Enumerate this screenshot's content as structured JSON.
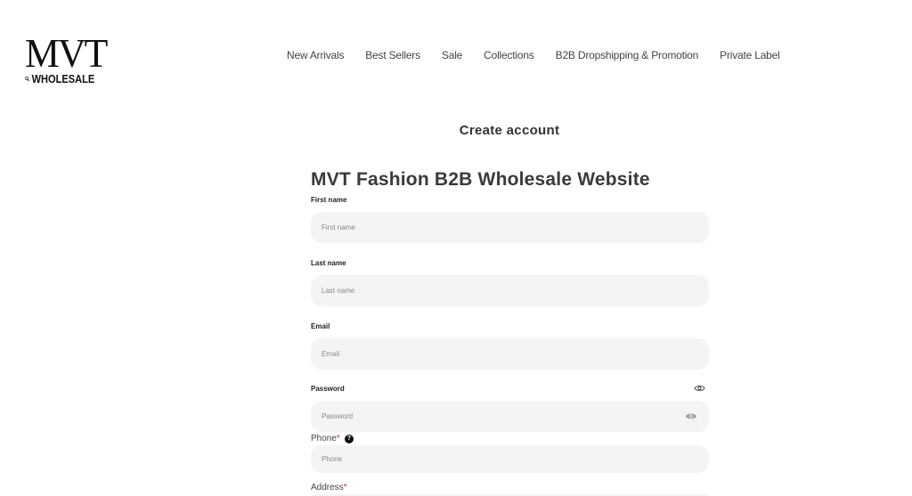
{
  "header": {
    "logo_mark": "MVT",
    "logo_sub": "WHOLESALE",
    "nav": [
      {
        "label": "New Arrivals"
      },
      {
        "label": "Best Sellers"
      },
      {
        "label": "Sale"
      },
      {
        "label": "Collections"
      },
      {
        "label": "B2B Dropshipping & Promotion"
      },
      {
        "label": "Private Label"
      }
    ]
  },
  "form": {
    "page_title": "Create account",
    "store_title": "MVT Fashion B2B Wholesale Website",
    "first_name": {
      "label": "First name",
      "placeholder": "First name"
    },
    "last_name": {
      "label": "Last name",
      "placeholder": "Last name"
    },
    "email": {
      "label": "Email",
      "placeholder": "Email"
    },
    "password": {
      "label": "Password",
      "placeholder": "Password"
    },
    "phone": {
      "label": "Phone",
      "required_mark": "*",
      "help": "?",
      "placeholder": "Phone"
    },
    "address": {
      "label": "Address",
      "required_mark": "*"
    }
  },
  "colors": {
    "field_bg": "#f4f4f4",
    "required": "#c0392b",
    "text": "#222222"
  }
}
